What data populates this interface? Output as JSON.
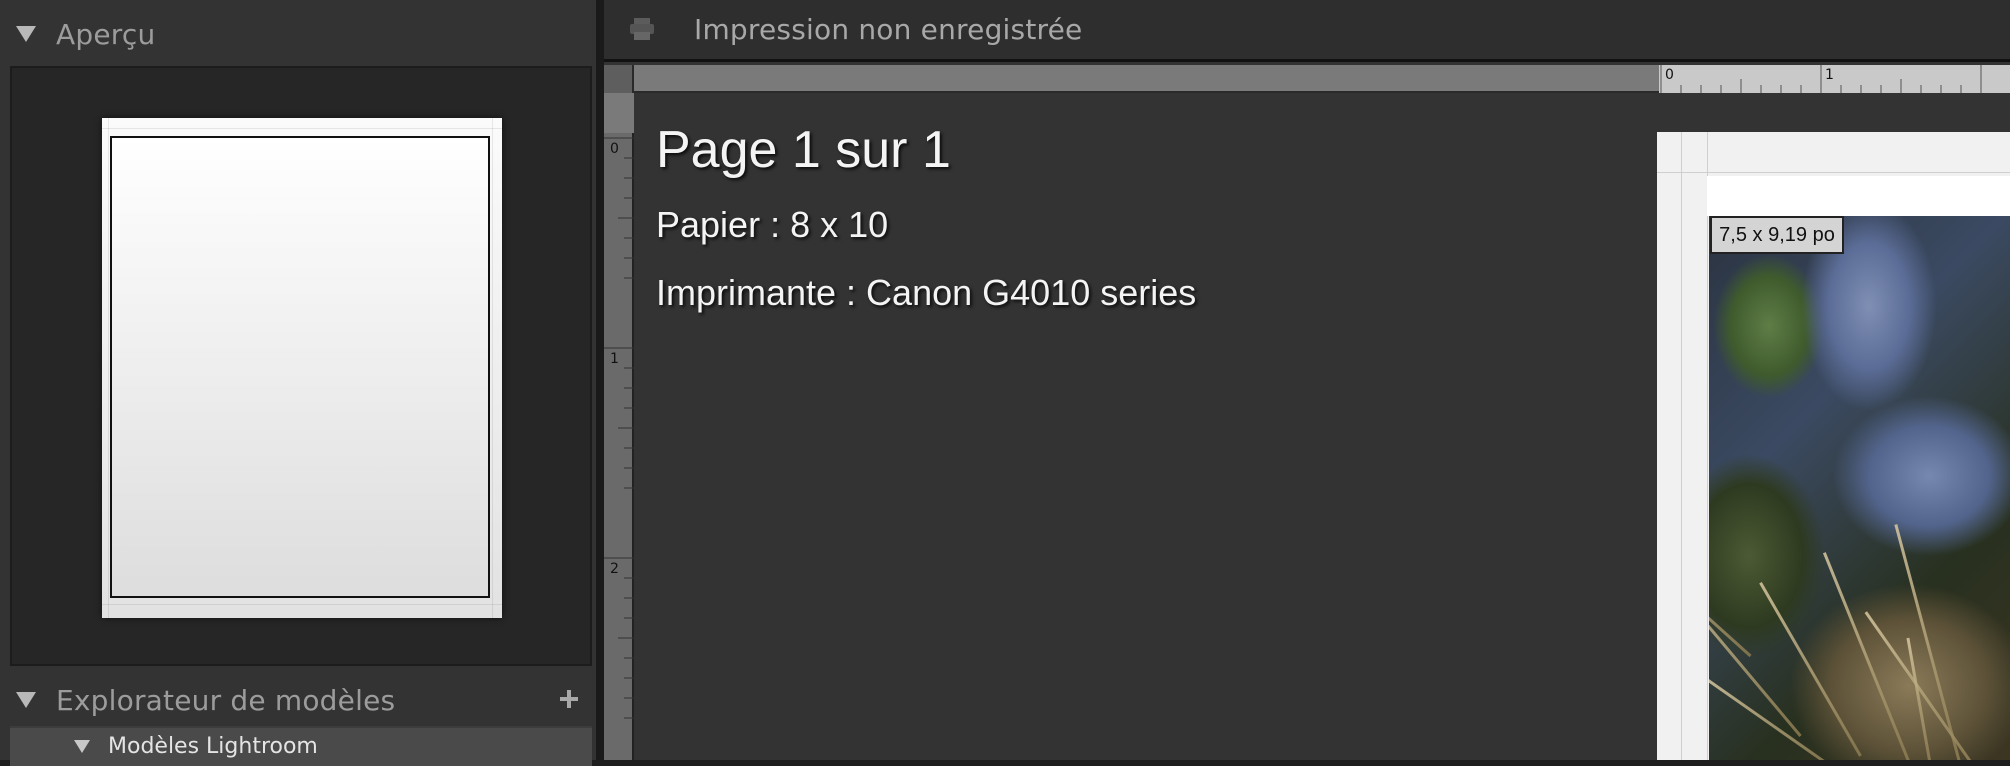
{
  "left_panel": {
    "preview_section": {
      "title": "Aperçu"
    },
    "template_browser": {
      "title": "Explorateur de modèles",
      "add_icon": "plus-icon",
      "folders": [
        {
          "label": "Modèles Lightroom"
        }
      ]
    }
  },
  "toolbar": {
    "icon": "print-icon",
    "title": "Impression non enregistrée"
  },
  "rulers": {
    "horizontal_labels": [
      "0",
      "1"
    ],
    "vertical_labels": [
      "0",
      "1",
      "2"
    ]
  },
  "page_info": {
    "page": "Page 1 sur 1",
    "paper": "Papier : 8 x 10",
    "printer": "Imprimante : Canon G4010 series"
  },
  "photo": {
    "size_label": "7,5 x 9,19 po"
  },
  "colors": {
    "panel_bg": "#333333",
    "dark_bg": "#1e1e1e",
    "text_light": "#f4f4f4",
    "text_muted": "#9c9c9c"
  }
}
